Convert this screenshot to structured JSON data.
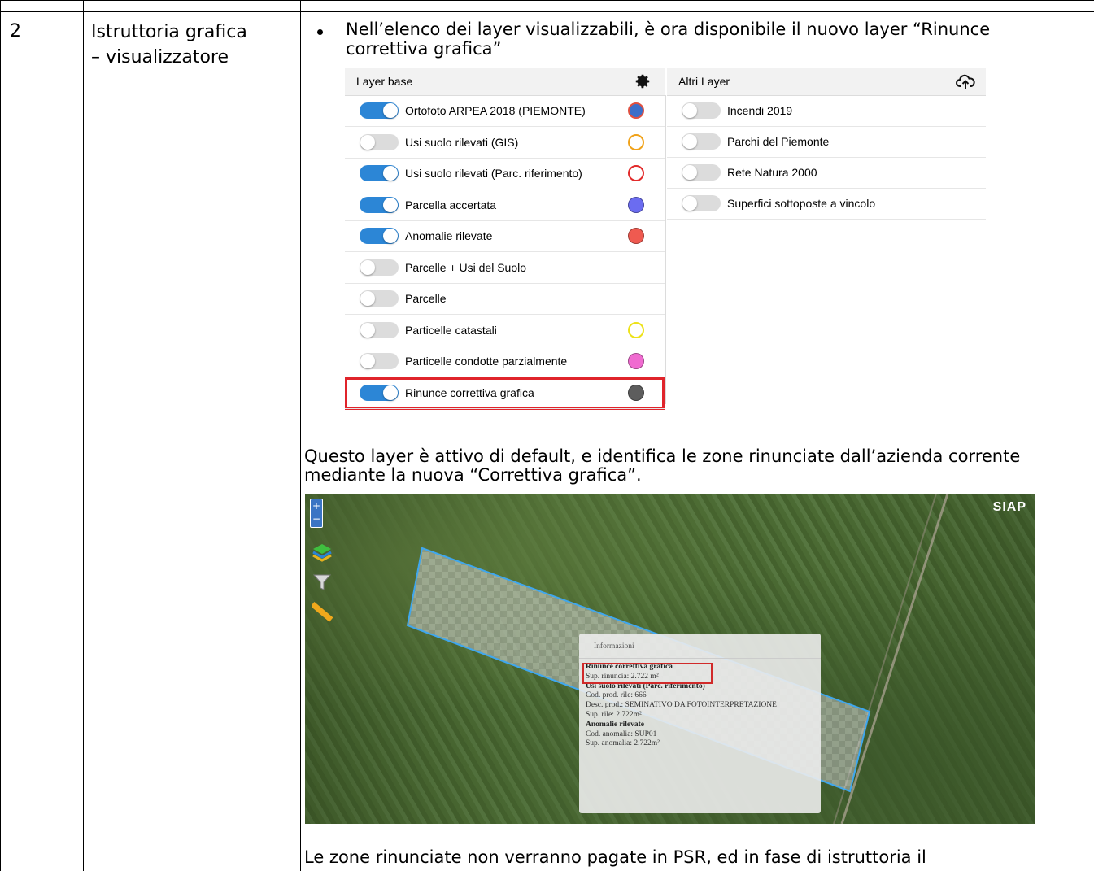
{
  "row": {
    "number": "2",
    "title_line1": "Istruttoria grafica",
    "title_line2": "– visualizzatore",
    "bullet": "Nell’elenco dei layer visualizzabili, è ora disponibile il nuovo layer “Rinunce correttiva grafica”",
    "paragraph1": "Questo layer è attivo di default, e identifica le zone rinunciate dall’azienda corrente mediante la nuova “Correttiva grafica”.",
    "paragraph2": "Le zone rinunciate non verranno pagate in PSR, ed in fase di istruttoria il"
  },
  "layer_panel": {
    "base_header": "Layer base",
    "alt_header": "Altri Layer",
    "base_header_icon": "gear-icon",
    "alt_header_icon": "cloud-upload-icon",
    "base_layers": [
      {
        "label": "Ortofoto ARPEA 2018 (PIEMONTE)",
        "on": true,
        "swatch": "calendar",
        "color": "#3b6fc9"
      },
      {
        "label": "Usi suolo rilevati (GIS)",
        "on": false,
        "swatch": "ring",
        "color": "#f0a21a"
      },
      {
        "label": "Usi suolo rilevati (Parc. riferimento)",
        "on": true,
        "swatch": "ring",
        "color": "#e22a2a"
      },
      {
        "label": "Parcella accertata",
        "on": true,
        "swatch": "fill",
        "color": "#6b6cf0"
      },
      {
        "label": "Anomalie rilevate",
        "on": true,
        "swatch": "fill",
        "color": "#ef5a50"
      },
      {
        "label": "Parcelle + Usi del Suolo",
        "on": false,
        "swatch": "none",
        "color": ""
      },
      {
        "label": "Parcelle",
        "on": false,
        "swatch": "none",
        "color": ""
      },
      {
        "label": "Particelle catastali",
        "on": false,
        "swatch": "ring",
        "color": "#ede21a"
      },
      {
        "label": "Particelle condotte parzialmente",
        "on": false,
        "swatch": "fill",
        "color": "#f06bd0"
      },
      {
        "label": "Rinunce correttiva grafica",
        "on": true,
        "swatch": "fill",
        "color": "#5d5d5d"
      }
    ],
    "alt_layers": [
      {
        "label": "Incendi 2019",
        "on": false
      },
      {
        "label": "Parchi del Piemonte",
        "on": false
      },
      {
        "label": "Rete Natura 2000",
        "on": false
      },
      {
        "label": "Superfici sottoposte a vincolo",
        "on": false
      }
    ]
  },
  "map": {
    "logo": "SIAP",
    "zoom_in": "+",
    "zoom_out": "−",
    "popup": {
      "title": "Informazioni",
      "lines": [
        {
          "text": "Rinunce correttiva grafica",
          "bold": true
        },
        {
          "text": "Sup. rinuncia: 2.722 m²",
          "bold": false
        },
        {
          "text": "Usi suolo rilevati (Parc. riferimento)",
          "bold": true
        },
        {
          "text": "Cod. prod. rile: 666",
          "bold": false
        },
        {
          "text": "Desc. prod.: SEMINATIVO DA FOTOINTERPRETAZIONE",
          "bold": false
        },
        {
          "text": "Sup. rile: 2.722m²",
          "bold": false
        },
        {
          "text": "Anomalie rilevate",
          "bold": true
        },
        {
          "text": "Cod. anomalia: SUP01",
          "bold": false
        },
        {
          "text": "Sup. anomalia: 2.722m²",
          "bold": false
        }
      ]
    }
  }
}
